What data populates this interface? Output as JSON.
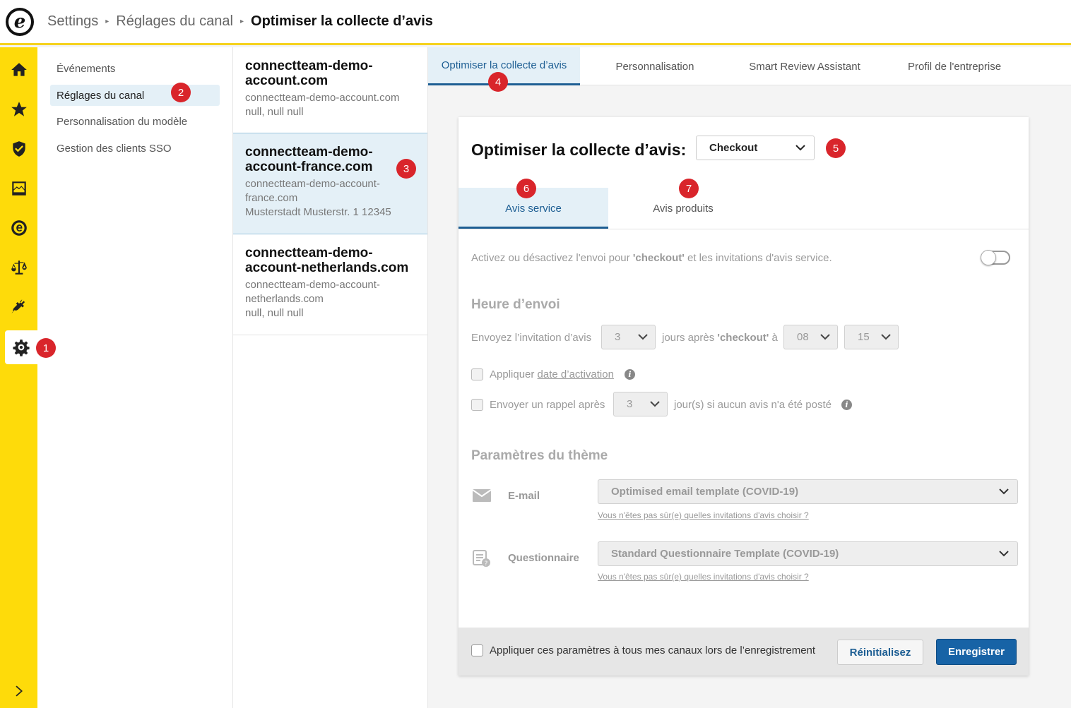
{
  "header": {
    "logo_letter": "e",
    "breadcrumb": [
      "Settings",
      "Réglages du canal",
      "Optimiser la collecte d’avis"
    ]
  },
  "rail": {
    "items": [
      "home-icon",
      "star-icon",
      "shield-check-icon",
      "chart-icon",
      "trustmark-icon",
      "scale-icon",
      "plug-icon",
      "gear-icon"
    ],
    "active": "gear-icon",
    "expand_icon": "chevron-right-icon"
  },
  "subnav": {
    "items": [
      {
        "label": "Événements"
      },
      {
        "label": "Réglages du canal",
        "active": true
      },
      {
        "label": "Personnalisation du modèle"
      },
      {
        "label": "Gestion des clients SSO"
      }
    ]
  },
  "channels": [
    {
      "name": "connectteam-demo-account.com",
      "name_lines": [
        "connectteam-demo-",
        "account.com"
      ],
      "url_lines": [
        "connectteam-demo-account.com"
      ],
      "address": "null, null null"
    },
    {
      "name": "connectteam-demo-account-france.com",
      "name_lines": [
        "connectteam-demo-",
        "account-france.com"
      ],
      "url_lines": [
        "connectteam-demo-account-",
        "france.com"
      ],
      "address": "Musterstadt Musterstr. 1 12345",
      "active": true
    },
    {
      "name": "connectteam-demo-account-netherlands.com",
      "name_lines": [
        "connectteam-demo-",
        "account-netherlands.com"
      ],
      "url_lines": [
        "connectteam-demo-account-",
        "netherlands.com"
      ],
      "address": "null, null null"
    }
  ],
  "tabs": [
    {
      "label": "Optimiser la collecte d’avis",
      "active": true
    },
    {
      "label": "Personnalisation"
    },
    {
      "label": "Smart Review Assistant"
    },
    {
      "label": "Profil de l'entreprise"
    }
  ],
  "card": {
    "title": "Optimiser la collecte d’avis:",
    "event_select": "Checkout",
    "subtabs": [
      {
        "label": "Avis service",
        "active": true
      },
      {
        "label": "Avis produits"
      }
    ],
    "toggle_text_before": "Activez ou désactivez l'envoi pour ",
    "toggle_text_bold": "'checkout'",
    "toggle_text_after": " et les invitations d'avis service.",
    "toggle_on": false,
    "send_time": {
      "title": "Heure d’envoi",
      "text_before": "Envoyez l’invitation d’avis",
      "days": "3",
      "text_mid_before": "jours après ",
      "text_mid_bold": "'checkout'",
      "text_mid_after": " à",
      "hour": "08",
      "minute": "15"
    },
    "activation": {
      "text_before": "Appliquer ",
      "link": "date d’activation",
      "checked": false
    },
    "reminder": {
      "text_before": "Envoyer un rappel après",
      "days": "3",
      "text_after": "jour(s) si aucun avis n'a été posté",
      "checked": false
    },
    "theme": {
      "title": "Paramètres du thème",
      "email_label": "E-mail",
      "email_select": "Optimised email template (COVID-19)",
      "email_help": "Vous n'êtes pas sûr(e) quelles invitations d'avis choisir ?",
      "questionnaire_label": "Questionnaire",
      "questionnaire_select": "Standard Questionnaire Template (COVID-19)",
      "questionnaire_help": "Vous n'êtes pas sûr(e) quelles invitations d'avis choisir ?"
    },
    "footer": {
      "apply_all": "Appliquer ces paramètres à tous mes canaux lors de l’enregistrement",
      "reset": "Réinitialisez",
      "save": "Enregistrer"
    }
  },
  "markers": [
    "1",
    "2",
    "3",
    "4",
    "5",
    "6",
    "7"
  ],
  "colors": {
    "accent": "#fedb0a",
    "primary": "#1763a6",
    "marker": "#d9252b",
    "active_bg": "#e4f0f7"
  }
}
